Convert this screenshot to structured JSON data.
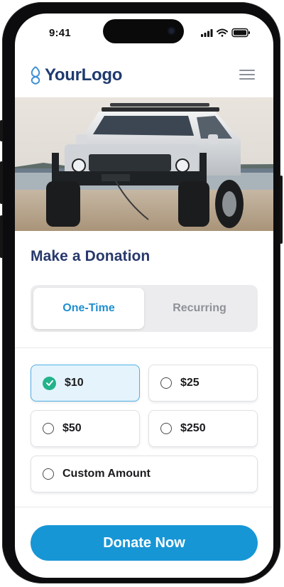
{
  "status_bar": {
    "time": "9:41"
  },
  "header": {
    "logo_text": "YourLogo",
    "menu_icon": "hamburger-menu-icon"
  },
  "hero": {
    "image": "suv-on-beach-photo"
  },
  "donation": {
    "title": "Make a Donation",
    "tabs": [
      {
        "label": "One-Time",
        "active": true
      },
      {
        "label": "Recurring",
        "active": false
      }
    ],
    "amounts": [
      {
        "label": "$10",
        "selected": true
      },
      {
        "label": "$25",
        "selected": false
      },
      {
        "label": "$50",
        "selected": false
      },
      {
        "label": "$250",
        "selected": false
      },
      {
        "label": "Custom Amount",
        "selected": false
      }
    ],
    "donate_button": "Donate Now"
  },
  "colors": {
    "brand_navy": "#27386b",
    "accent_blue": "#1796d6",
    "selected_bg": "#e5f3fc",
    "check_green": "#23b38a"
  }
}
